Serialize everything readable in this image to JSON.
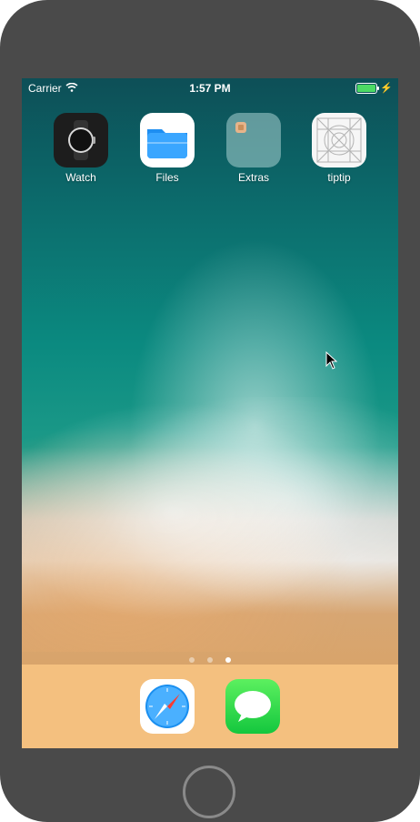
{
  "status_bar": {
    "carrier": "Carrier",
    "time": "1:57 PM",
    "wifi_icon": "wifi-icon",
    "battery_icon": "battery-icon",
    "battery_color": "#4cd964",
    "charging_icon": "charging-bolt-icon"
  },
  "home_screen": {
    "apps": [
      {
        "label": "Watch",
        "icon": "watch-icon"
      },
      {
        "label": "Files",
        "icon": "files-icon"
      },
      {
        "label": "Extras",
        "icon": "folder-icon"
      },
      {
        "label": "tiptip",
        "icon": "app-grid-icon"
      }
    ],
    "page_dots": {
      "count": 3,
      "active_index": 2
    }
  },
  "dock": {
    "apps": [
      {
        "label": "Safari",
        "icon": "safari-icon"
      },
      {
        "label": "Messages",
        "icon": "messages-icon"
      }
    ],
    "color": "#f4c07f"
  },
  "device": {
    "frame_color": "#4a4a4a",
    "home_button_icon": "home-button"
  }
}
